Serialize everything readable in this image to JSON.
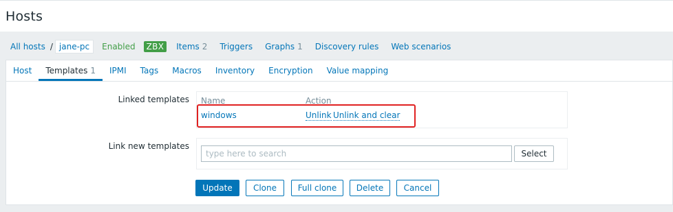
{
  "header": {
    "title": "Hosts"
  },
  "breadcrumbs": {
    "all_hosts": "All hosts",
    "separator": "/",
    "current_host": "jane-pc"
  },
  "host_nav": {
    "status": "Enabled",
    "status_color": "#429e47",
    "zbx_badge": "ZBX",
    "items": {
      "label": "Items",
      "count": "2"
    },
    "triggers": {
      "label": "Triggers"
    },
    "graphs": {
      "label": "Graphs",
      "count": "1"
    },
    "discovery_rules": {
      "label": "Discovery rules"
    },
    "web_scenarios": {
      "label": "Web scenarios"
    }
  },
  "tabs": [
    {
      "label": "Host",
      "count": ""
    },
    {
      "label": "Templates",
      "count": "1",
      "active": true
    },
    {
      "label": "IPMI",
      "count": ""
    },
    {
      "label": "Tags",
      "count": ""
    },
    {
      "label": "Macros",
      "count": ""
    },
    {
      "label": "Inventory",
      "count": ""
    },
    {
      "label": "Encryption",
      "count": ""
    },
    {
      "label": "Value mapping",
      "count": ""
    }
  ],
  "form": {
    "linked_templates": {
      "label": "Linked templates",
      "col_name": "Name",
      "col_action": "Action",
      "rows": [
        {
          "name": "windows",
          "unlink": "Unlink",
          "unlink_and_clear": "Unlink and clear"
        }
      ]
    },
    "link_new": {
      "label": "Link new templates",
      "placeholder": "type here to search",
      "select_label": "Select"
    },
    "buttons": {
      "update": "Update",
      "clone": "Clone",
      "full_clone": "Full clone",
      "delete": "Delete",
      "cancel": "Cancel"
    }
  },
  "colors": {
    "accent": "#0275b8",
    "highlight": "#e02020",
    "background": "#ebeef0"
  }
}
